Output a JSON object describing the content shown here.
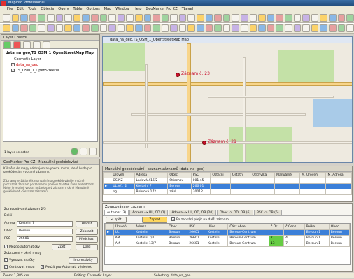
{
  "app": {
    "title": "MapInfo Professional"
  },
  "menu": [
    "File",
    "Edit",
    "Tools",
    "Objects",
    "Query",
    "Table",
    "Options",
    "Map",
    "Window",
    "Help",
    "GeoMarker Pro CZ",
    "TLevel"
  ],
  "layer_control": {
    "title": "Layer Control",
    "root": "data_na_geo,TS_OSM_1_OpenStreetMap Map",
    "layers": [
      "Cosmetic Layer",
      "data_na_geo",
      "TS_OSM_1_OpenStreetM"
    ],
    "status": "1 layer selected"
  },
  "map": {
    "title": "data_na_geo,TS_OSM_1_OpenStreetMap Map",
    "labels": [
      "Záznam č. 23",
      "Záznam č. 21"
    ]
  },
  "geomarker": {
    "title": "GeoMarker Pro CZ - Manuální geokódování",
    "hint1": "Klikněte do mapy nástrojem",
    "hint2": "a vyberte místo, které bude pro geokódování vybrané záznamy.",
    "desc": "Záznamy vyžádané k manuálnímu geokódování je možné procházet záznam po záznamu pomocí tlačítek Další a Předchozí. Nebo je možné vybrat požadovaný záznam v okně Manuálně geokódovat - Seznam záznamů.",
    "record_title": "Zpracovávaný záznam 2/5",
    "label_dalsi": "Další",
    "adresa_label": "Adresa",
    "adresa": "Kostelní 7",
    "obec_label": "Obec",
    "obec": "Beroun",
    "psc_label": "PSČ",
    "psc": "26601",
    "hledat": "Hledat",
    "zobrazit": "Zobrazit",
    "predchozi": "Předchozí",
    "mezdo": "Mezdo automaticky",
    "zpet": "Zpět",
    "dalsi": "Další",
    "zobrazeni": "Zobrazení v okně mapy",
    "vymazat": "Vymazat značky",
    "imprs": "Impressivity",
    "centrovat": "Centrovat mapu",
    "pouzit": "Použít pro Automat. výsledek"
  },
  "list_title": "Manuální geokódování - seznam záznamů (data_na_geo)",
  "top_table": {
    "headers": [
      "",
      "Úroveň",
      "Adresa",
      "Obec",
      "PSČ",
      "Ostatní",
      "Ostatní",
      "Odchylka",
      "Manuálně",
      "M. Úroveň",
      "M. Adresa"
    ],
    "rows": [
      [
        "",
        "OS NZ",
        "Ladová 416/2",
        "Střechov",
        "001 45",
        "",
        "",
        "",
        "",
        "",
        ""
      ],
      [
        "►",
        "UL.V/1_2",
        "Kostelní 7",
        "Beroun",
        "266 01",
        "",
        "",
        "",
        "",
        "",
        ""
      ],
      [
        "",
        "ng",
        "Bobrová 172",
        "záhl",
        "30012",
        "",
        "",
        "",
        "",
        "",
        ""
      ]
    ]
  },
  "processed": {
    "title": "Zpracovávaný záznam",
    "tabs": [
      "Automat (3)",
      "Adresa -> UL, OD (1)",
      "Adresa -> UL, OD, OB (20)",
      "Obec -> OD, OB (6)",
      "PSČ -> OB (5)"
    ],
    "back": "< zpět",
    "zapsat": "Zapsat",
    "checkbox": "Po zapsání přejít na další záznam",
    "headers": [
      "",
      "Úroveň",
      "Adresa",
      "Obec",
      "PSČ",
      "Ulice",
      "Část obce",
      "č.Or.",
      "č.Cenz.",
      "Pořka",
      "Obec"
    ],
    "rows": [
      [
        "►",
        "UL",
        "Kostelní",
        "Beroun",
        "26601",
        "Kostelní",
        "Beroun-Centrum",
        "",
        "",
        "Beroun 1",
        "Beroun"
      ],
      [
        "",
        "AM",
        "Kostelní 7/4",
        "Beroun",
        "26601",
        "Kostelní",
        "Beroun-Centrum",
        "7",
        "4",
        "Beroun 1",
        "Beroun"
      ],
      [
        "",
        "AM",
        "Kostelní 13/7",
        "Beroun",
        "26601",
        "Kostelní",
        "Beroun-Centrum",
        "13",
        "7",
        "Beroun 1",
        "Beroun"
      ]
    ]
  },
  "status": {
    "zoom": "Zoom: 1,385 km",
    "editing": "Editing: Cosmetic Layer",
    "selecting": "Selecting: data_na_geo"
  }
}
